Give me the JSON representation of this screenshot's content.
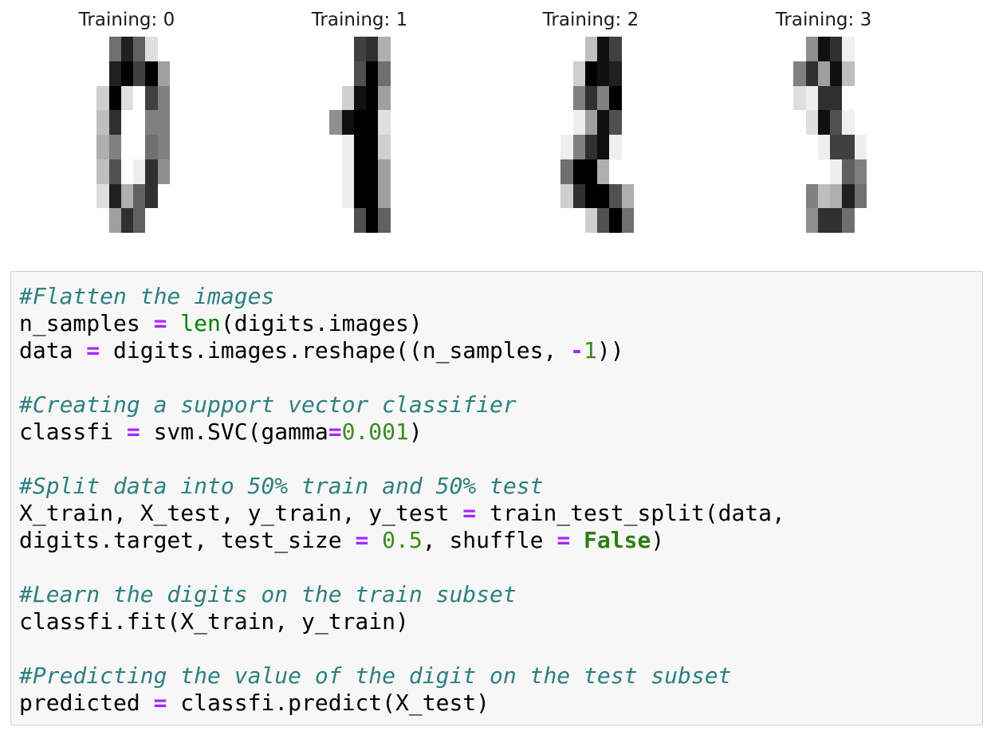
{
  "output": {
    "panels": [
      {
        "title": "Training: 0",
        "pixels": [
          [
            0,
            0,
            9,
            14,
            10,
            2,
            0,
            0
          ],
          [
            0,
            0,
            14,
            16,
            12,
            16,
            6,
            0
          ],
          [
            0,
            3,
            16,
            2,
            0,
            12,
            8,
            0
          ],
          [
            0,
            4,
            13,
            0,
            0,
            8,
            8,
            0
          ],
          [
            0,
            5,
            8,
            0,
            0,
            9,
            8,
            0
          ],
          [
            0,
            4,
            11,
            0,
            1,
            13,
            7,
            0
          ],
          [
            0,
            2,
            14,
            5,
            10,
            13,
            0,
            0
          ],
          [
            0,
            0,
            6,
            13,
            10,
            0,
            0,
            0
          ]
        ]
      },
      {
        "title": "Training: 1",
        "pixels": [
          [
            0,
            0,
            0,
            12,
            13,
            5,
            0,
            0
          ],
          [
            0,
            0,
            0,
            11,
            16,
            9,
            0,
            0
          ],
          [
            0,
            0,
            3,
            15,
            16,
            6,
            0,
            0
          ],
          [
            0,
            7,
            15,
            16,
            16,
            2,
            0,
            0
          ],
          [
            0,
            0,
            1,
            16,
            16,
            3,
            0,
            0
          ],
          [
            0,
            0,
            1,
            16,
            16,
            6,
            0,
            0
          ],
          [
            0,
            0,
            1,
            16,
            16,
            6,
            0,
            0
          ],
          [
            0,
            0,
            0,
            11,
            16,
            10,
            0,
            0
          ]
        ]
      },
      {
        "title": "Training: 2",
        "pixels": [
          [
            0,
            0,
            0,
            4,
            15,
            12,
            0,
            0
          ],
          [
            0,
            0,
            3,
            16,
            15,
            14,
            0,
            0
          ],
          [
            0,
            0,
            8,
            13,
            8,
            16,
            0,
            0
          ],
          [
            0,
            0,
            1,
            6,
            15,
            11,
            0,
            0
          ],
          [
            0,
            1,
            8,
            13,
            15,
            1,
            0,
            0
          ],
          [
            0,
            9,
            16,
            16,
            5,
            0,
            0,
            0
          ],
          [
            0,
            3,
            13,
            16,
            16,
            11,
            5,
            0
          ],
          [
            0,
            0,
            0,
            3,
            11,
            16,
            9,
            0
          ]
        ]
      },
      {
        "title": "Training: 3",
        "pixels": [
          [
            0,
            0,
            7,
            15,
            13,
            1,
            0,
            0
          ],
          [
            0,
            8,
            13,
            6,
            15,
            4,
            0,
            0
          ],
          [
            0,
            2,
            1,
            13,
            13,
            0,
            0,
            0
          ],
          [
            0,
            0,
            2,
            15,
            11,
            1,
            0,
            0
          ],
          [
            0,
            0,
            0,
            1,
            12,
            12,
            1,
            0
          ],
          [
            0,
            0,
            0,
            0,
            1,
            10,
            8,
            0
          ],
          [
            0,
            0,
            8,
            4,
            5,
            14,
            9,
            0
          ],
          [
            0,
            0,
            7,
            13,
            13,
            9,
            0,
            0
          ]
        ]
      }
    ]
  },
  "code": {
    "lines": [
      [
        {
          "t": "comment",
          "v": "#Flatten the images"
        }
      ],
      [
        {
          "t": "plain",
          "v": "n_samples "
        },
        {
          "t": "op",
          "v": "="
        },
        {
          "t": "plain",
          "v": " "
        },
        {
          "t": "builtin",
          "v": "len"
        },
        {
          "t": "plain",
          "v": "(digits.images)"
        }
      ],
      [
        {
          "t": "plain",
          "v": "data "
        },
        {
          "t": "op",
          "v": "="
        },
        {
          "t": "plain",
          "v": " digits.images.reshape((n_samples, "
        },
        {
          "t": "op",
          "v": "-"
        },
        {
          "t": "num",
          "v": "1"
        },
        {
          "t": "plain",
          "v": "))"
        }
      ],
      [],
      [
        {
          "t": "comment",
          "v": "#Creating a support vector classifier"
        }
      ],
      [
        {
          "t": "plain",
          "v": "classfi "
        },
        {
          "t": "op",
          "v": "="
        },
        {
          "t": "plain",
          "v": " svm.SVC(gamma"
        },
        {
          "t": "op",
          "v": "="
        },
        {
          "t": "num",
          "v": "0.001"
        },
        {
          "t": "plain",
          "v": ")"
        }
      ],
      [],
      [
        {
          "t": "comment",
          "v": "#Split data into 50% train and 50% test"
        }
      ],
      [
        {
          "t": "plain",
          "v": "X_train, X_test, y_train, y_test "
        },
        {
          "t": "op",
          "v": "="
        },
        {
          "t": "plain",
          "v": " train_test_split(data,"
        }
      ],
      [
        {
          "t": "plain",
          "v": "digits.target, test_size "
        },
        {
          "t": "op",
          "v": "="
        },
        {
          "t": "plain",
          "v": " "
        },
        {
          "t": "num",
          "v": "0.5"
        },
        {
          "t": "plain",
          "v": ", shuffle "
        },
        {
          "t": "op",
          "v": "="
        },
        {
          "t": "plain",
          "v": " "
        },
        {
          "t": "kw",
          "v": "False"
        },
        {
          "t": "plain",
          "v": ")"
        }
      ],
      [],
      [
        {
          "t": "comment",
          "v": "#Learn the digits on the train subset"
        }
      ],
      [
        {
          "t": "plain",
          "v": "classfi.fit(X_train, y_train)"
        }
      ],
      [],
      [
        {
          "t": "comment",
          "v": "#Predicting the value of the digit on the test subset"
        }
      ],
      [
        {
          "t": "plain",
          "v": "predicted "
        },
        {
          "t": "op",
          "v": "="
        },
        {
          "t": "plain",
          "v": " classfi.predict(X_test)"
        }
      ]
    ]
  }
}
